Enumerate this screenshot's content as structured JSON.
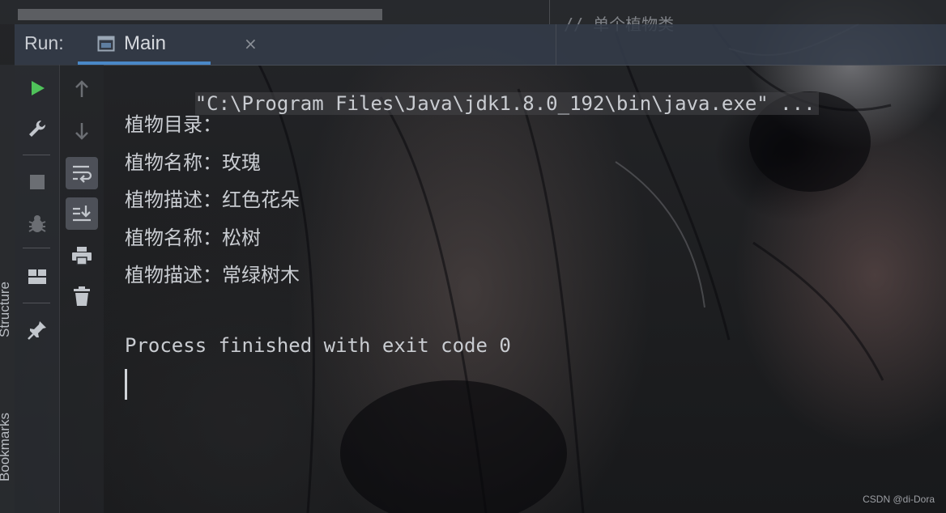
{
  "editor": {
    "comment_text": "// 单个植物类"
  },
  "run_panel": {
    "label": "Run:",
    "tab": {
      "label": "Main",
      "icon": "console-window-icon",
      "close_icon": "close-icon",
      "close_glyph": "×"
    }
  },
  "left_stripe": {
    "items": [
      "Structure",
      "Bookmarks"
    ]
  },
  "toolbar_primary": {
    "buttons": [
      {
        "icon": "run-icon",
        "label": "Rerun"
      },
      {
        "icon": "wrench-icon",
        "label": "Edit configurations"
      },
      {
        "icon": "stop-icon",
        "label": "Stop"
      },
      {
        "icon": "debug-bug-icon",
        "label": "Debug"
      },
      {
        "icon": "layout-icon",
        "label": "Restore layout"
      },
      {
        "icon": "pin-icon",
        "label": "Pin tab"
      }
    ]
  },
  "toolbar_secondary": {
    "buttons": [
      {
        "icon": "arrow-up-icon",
        "label": "Up the stack trace"
      },
      {
        "icon": "arrow-down-icon",
        "label": "Down the stack trace"
      },
      {
        "icon": "soft-wrap-icon",
        "label": "Soft-wrap"
      },
      {
        "icon": "scroll-to-end-icon",
        "label": "Scroll to end"
      },
      {
        "icon": "print-icon",
        "label": "Print"
      },
      {
        "icon": "trash-icon",
        "label": "Clear all"
      }
    ]
  },
  "console": {
    "command": "\"C:\\Program Files\\Java\\jdk1.8.0_192\\bin\\java.exe\" ...",
    "lines": [
      "植物目录：",
      "植物名称：玫瑰",
      "植物描述：红色花朵",
      "植物名称：松树",
      "植物描述：常绿树木"
    ],
    "exit_message": "Process finished with exit code 0"
  },
  "colors": {
    "accent": "#4a88c7",
    "run_green": "#4fc25a",
    "text": "#c9ccd1"
  },
  "watermark": "CSDN @di-Dora"
}
